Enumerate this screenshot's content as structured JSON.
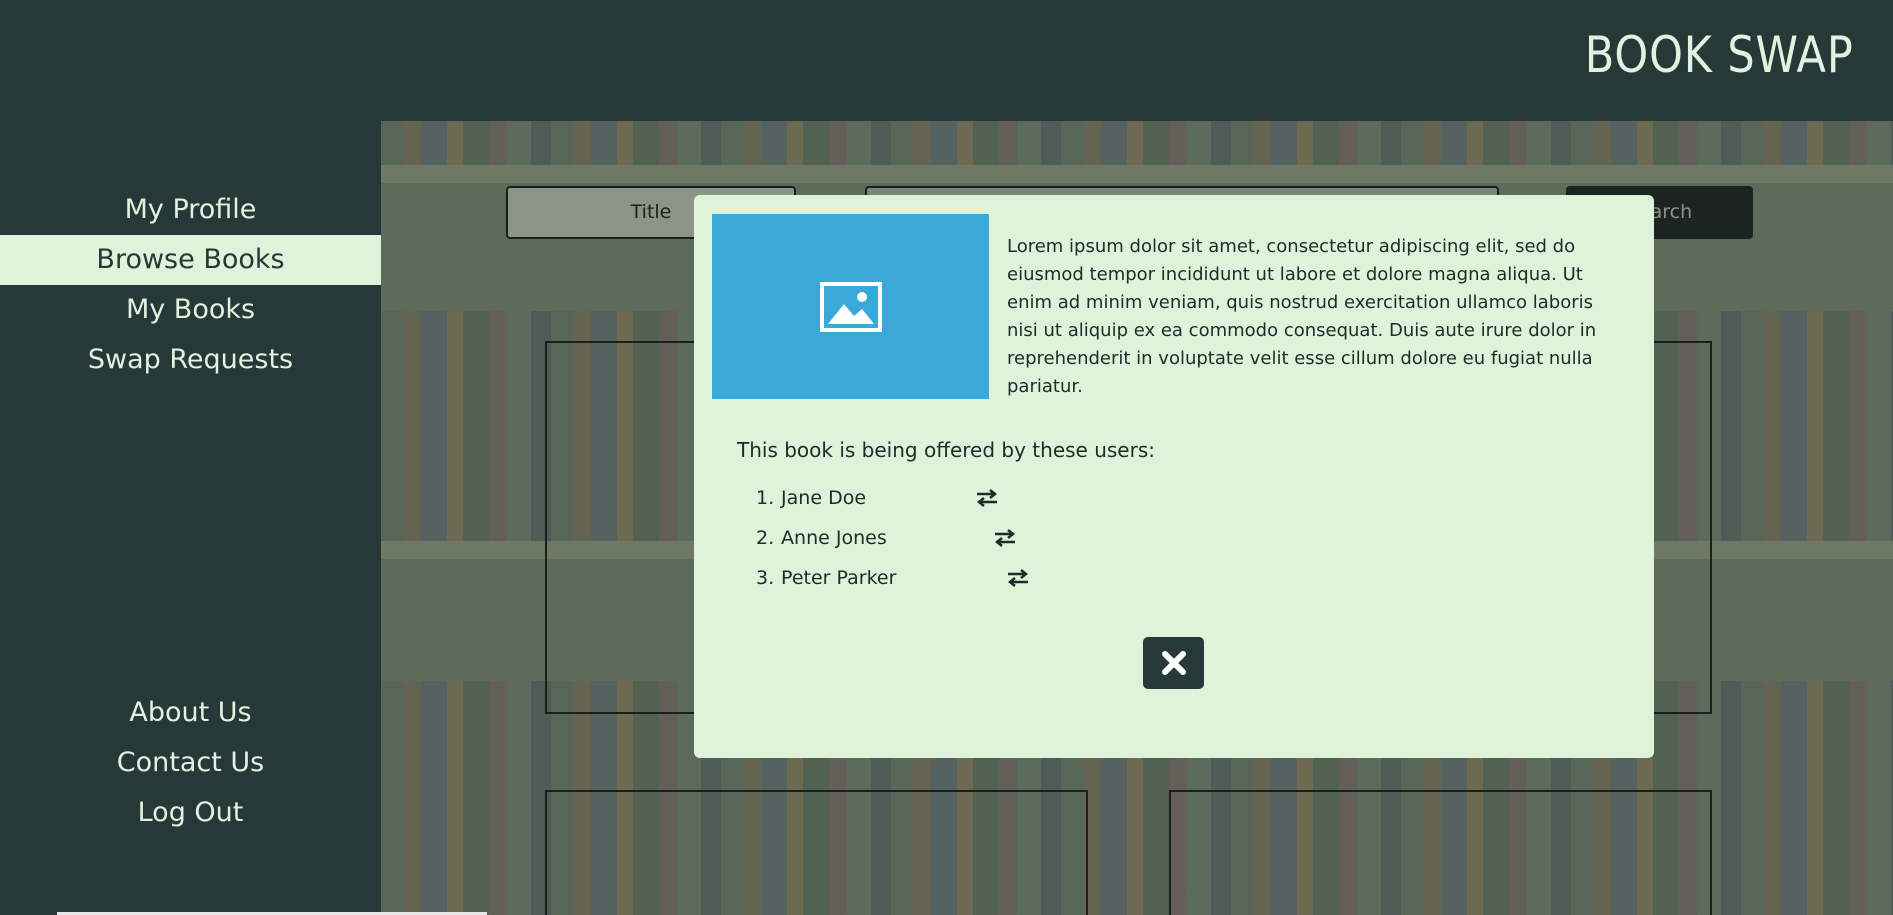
{
  "header": {
    "brand": "BOOK SWAP"
  },
  "sidebar": {
    "items": [
      {
        "label": "My Profile"
      },
      {
        "label": "Browse Books"
      },
      {
        "label": "My Books"
      },
      {
        "label": "Swap Requests"
      }
    ],
    "footer_items": [
      {
        "label": "About Us"
      },
      {
        "label": "Contact Us"
      },
      {
        "label": "Log Out"
      }
    ]
  },
  "search": {
    "select_value": "Title",
    "button_label": "Search"
  },
  "modal": {
    "image_icon": "image-icon",
    "description": "Lorem ipsum dolor sit amet, consectetur adipiscing elit, sed do eiusmod tempor incididunt ut labore et dolore magna aliqua. Ut enim ad minim veniam, quis nostrud exercitation ullamco laboris nisi ut aliquip ex ea commodo consequat. Duis aute irure dolor in reprehenderit in voluptate velit esse cillum dolore eu fugiat nulla pariatur.",
    "offered_heading": "This book is being offered by these users:",
    "users": [
      {
        "num": "1.",
        "name": "Jane Doe"
      },
      {
        "num": "2.",
        "name": "Anne Jones"
      },
      {
        "num": "3.",
        "name": "Peter Parker"
      }
    ],
    "swap_icon": "exchange-icon",
    "close_icon": "close-icon"
  },
  "colors": {
    "dark": "#263838",
    "light": "#dff2da",
    "image_placeholder": "#3aa8d8"
  }
}
